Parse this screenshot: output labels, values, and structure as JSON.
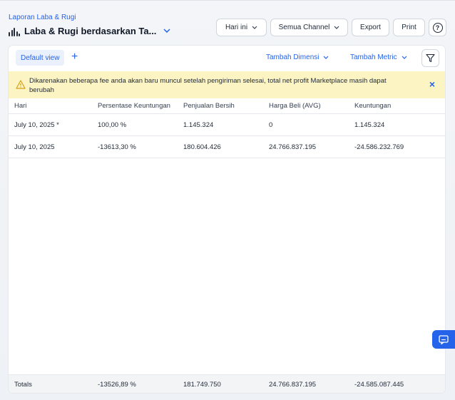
{
  "header": {
    "breadcrumb": "Laporan Laba & Rugi",
    "title": "Laba & Rugi berdasarkan Ta...",
    "actions": {
      "date_filter": "Hari ini",
      "channel_filter": "Semua Channel",
      "export_label": "Export",
      "print_label": "Print",
      "help_symbol": "?"
    }
  },
  "toolbar": {
    "view_tab": "Default view",
    "add_view_symbol": "+",
    "add_dimension": "Tambah Dimensi",
    "add_metric": "Tambah Metric"
  },
  "warning": {
    "text": "Dikarenakan beberapa fee anda akan baru muncul setelah pengiriman selesai, total net profit Marketplace masih dapat berubah",
    "close_symbol": "×"
  },
  "table": {
    "columns": [
      "Hari",
      "Persentase Keuntungan",
      "Penjualan Bersih",
      "Harga Beli (AVG)",
      "Keuntungan"
    ],
    "rows": [
      [
        "July 10, 2025 *",
        "100,00 %",
        "1.145.324",
        "0",
        "1.145.324"
      ],
      [
        "July 10, 2025",
        "-13613,30 %",
        "180.604.426",
        "24.766.837.195",
        "-24.586.232.769"
      ]
    ],
    "totals": [
      "Totals",
      "-13526,89 %",
      "181.749.750",
      "24.766.837.195",
      "-24.585.087.445"
    ]
  },
  "colors": {
    "accent": "#2563eb",
    "warning_bg": "#fdf4c3",
    "warning_icon": "#d4a017"
  }
}
